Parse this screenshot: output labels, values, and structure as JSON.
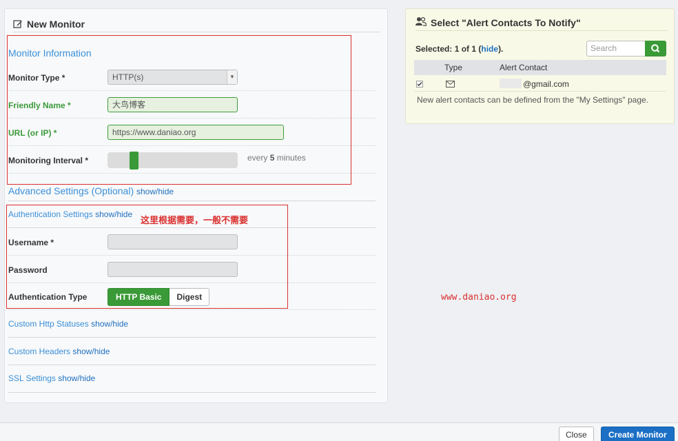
{
  "left_panel": {
    "title": "New Monitor",
    "monitor_info": {
      "section_title": "Monitor Information",
      "monitor_type_label": "Monitor Type *",
      "monitor_type_value": "HTTP(s)",
      "friendly_name_label": "Friendly Name *",
      "friendly_name_value": "大鸟博客",
      "url_label": "URL (or IP) *",
      "url_value": "https://www.daniao.org",
      "interval_label": "Monitoring Interval *",
      "interval_prefix": "every",
      "interval_value": "5",
      "interval_suffix": "minutes",
      "interval_level_fraction": 0.2
    },
    "advanced": {
      "title": "Advanced Settings (Optional)",
      "toggle": "show/hide"
    },
    "auth": {
      "title": "Authentication Settings",
      "toggle": "show/hide",
      "username_label": "Username *",
      "username_value": "",
      "password_label": "Password",
      "password_value": "",
      "auth_type_label": "Authentication Type",
      "auth_http_basic": "HTTP Basic",
      "auth_digest": "Digest"
    },
    "custom_http": {
      "title": "Custom Http Statuses",
      "toggle": "show/hide"
    },
    "custom_headers": {
      "title": "Custom Headers",
      "toggle": "show/hide"
    },
    "ssl": {
      "title": "SSL Settings",
      "toggle": "show/hide"
    }
  },
  "annotation": "这里根据需要，一般不需要",
  "watermark": "www.daniao.org",
  "right_panel": {
    "title": "Select \"Alert Contacts To Notify\"",
    "selected_prefix": "Selected:",
    "selected_count": "1 of 1",
    "hide_link": "hide",
    "search_placeholder": "Search",
    "col_type": "Type",
    "col_contact": "Alert Contact",
    "contact_email": "@gmail.com",
    "note": "New alert contacts can be defined from the \"My Settings\" page."
  },
  "footer": {
    "close_label": "Close",
    "create_label": "Create Monitor"
  },
  "colors": {
    "accent_blue": "#3a8fd8",
    "success_green": "#3a9a37",
    "annotation_red": "#d9302f",
    "primary_button": "#1b6fc4"
  }
}
